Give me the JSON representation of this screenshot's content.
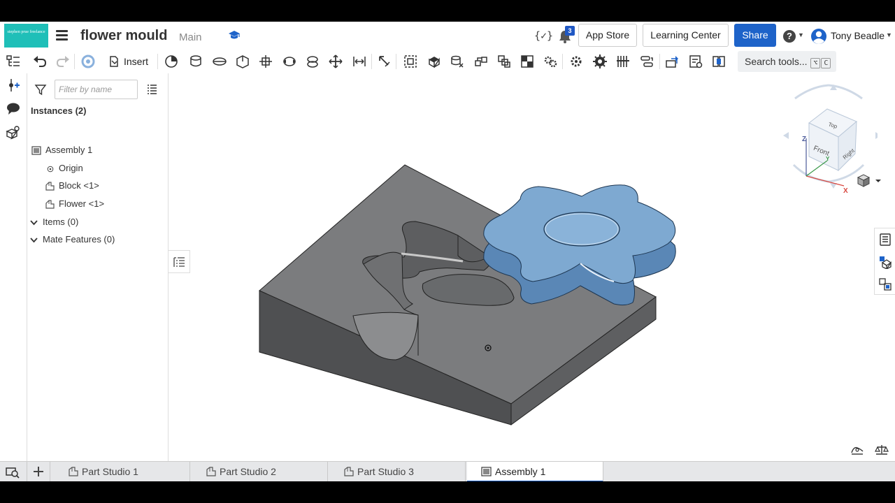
{
  "header": {
    "logo_text": "stephen prue freelance",
    "title": "flower mould",
    "branch": "Main",
    "variables_label": "{✓}",
    "notifications_count": "3",
    "app_store": "App Store",
    "learning_center": "Learning Center",
    "share": "Share",
    "help_glyph": "?",
    "user_name": "Tony Beadle"
  },
  "toolbar": {
    "insert_label": "Insert",
    "search_placeholder": "Search tools...",
    "search_key1": "⌥",
    "search_key2": "C"
  },
  "panel": {
    "filter_placeholder": "Filter by name",
    "instances_header": "Instances (2)",
    "tree": [
      {
        "label": "Assembly 1"
      },
      {
        "label": "Origin"
      },
      {
        "label": "Block <1>"
      },
      {
        "label": "Flower <1>"
      },
      {
        "label": "Items (0)"
      },
      {
        "label": "Mate Features (0)"
      }
    ]
  },
  "viewcube": {
    "top": "Top",
    "front": "Front",
    "right": "Right",
    "axis_z": "Z",
    "axis_x": "X",
    "axis_y": "Y"
  },
  "tabs": [
    {
      "label": "Part Studio 1",
      "active": false
    },
    {
      "label": "Part Studio 2",
      "active": false
    },
    {
      "label": "Part Studio 3",
      "active": false
    },
    {
      "label": "Assembly 1",
      "active": true
    }
  ],
  "colors": {
    "brand_logo": "#1fbfb8",
    "share_blue": "#1e63c9",
    "part_gray": "#7d7e80",
    "flower_blue": "#7ea9d1"
  }
}
